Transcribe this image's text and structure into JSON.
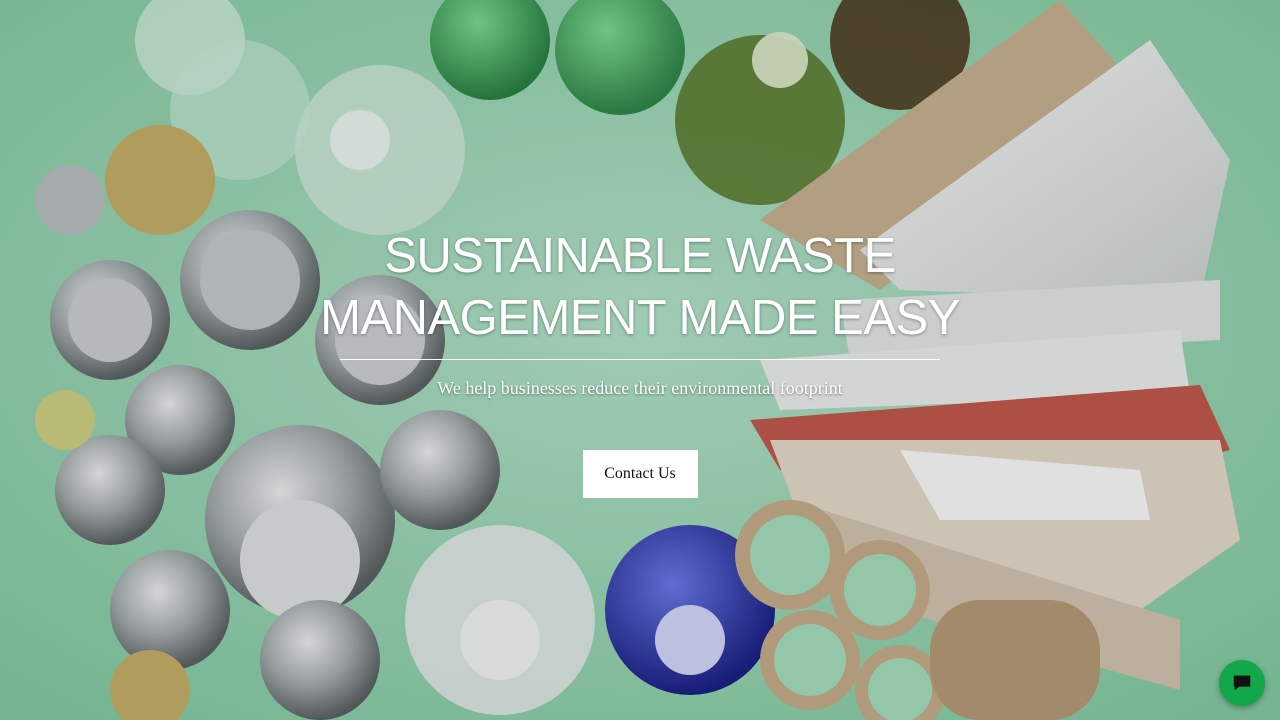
{
  "hero": {
    "title": "SUSTAINABLE WASTE MANAGEMENT MADE EASY",
    "subtitle": "We help businesses reduce their environmental footprint",
    "cta_label": "Contact Us",
    "background_icon": "recycling-materials-image",
    "background_color": "#9fd9b9"
  },
  "chat": {
    "icon": "chat-bubble-icon",
    "color": "#12a84a"
  }
}
